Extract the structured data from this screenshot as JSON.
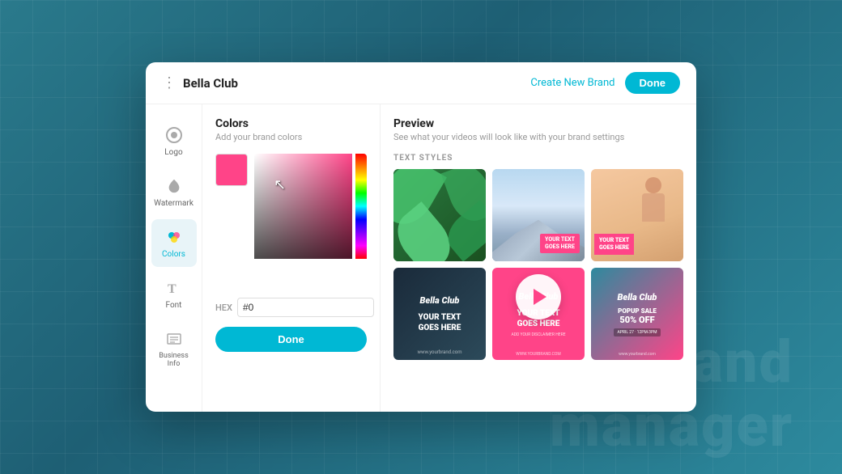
{
  "background": {
    "text_line1": "brand",
    "text_line2": "manager"
  },
  "header": {
    "menu_icon": "⋮",
    "brand_name": "Bella Club",
    "create_brand_label": "Create New Brand",
    "done_label": "Done"
  },
  "sidebar": {
    "items": [
      {
        "id": "logo",
        "label": "Logo",
        "active": false
      },
      {
        "id": "watermark",
        "label": "Watermark",
        "active": false
      },
      {
        "id": "colors",
        "label": "Colors",
        "active": true
      },
      {
        "id": "font",
        "label": "Font",
        "active": false
      },
      {
        "id": "business",
        "label": "Business Info",
        "active": false
      }
    ]
  },
  "colors_panel": {
    "title": "Colors",
    "subtitle": "Add your brand colors",
    "hex_label": "HEX",
    "hex_value": "#0",
    "done_label": "Done"
  },
  "preview_panel": {
    "title": "Preview",
    "subtitle": "See what your videos will look like with your brand settings",
    "text_styles_label": "TEXT STYLES",
    "cards": [
      {
        "id": "tropical",
        "type": "image"
      },
      {
        "id": "mountain",
        "type": "image",
        "text": "YOUR TEXT\nGOES HERE"
      },
      {
        "id": "woman",
        "type": "image",
        "text": "YOUR TEXT\nGOES HERE"
      },
      {
        "id": "dark",
        "type": "branded",
        "logo": "Bella Club",
        "text": "YOUR TEXT\nGOES HERE",
        "website": "www.yourbrand.com"
      },
      {
        "id": "pink",
        "type": "branded",
        "logo": "Bella Club",
        "text": "YOUR TEXT\nGOES HERE",
        "disclaimer": "ADD YOUR DISCLAIMER HERE",
        "website": "WWW.YOURBRAND.COM"
      },
      {
        "id": "popup",
        "type": "branded",
        "logo": "Bella Club",
        "popup_title": "POPUP SALE",
        "popup_percent": "50% OFF",
        "date": "APRIL 27 · 12PM-3PM",
        "website": "www.yourbrand.com"
      }
    ]
  }
}
